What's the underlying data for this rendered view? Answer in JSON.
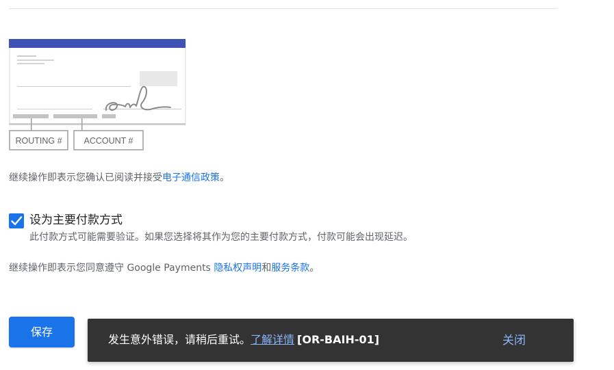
{
  "illustration": {
    "routing_label": "ROUTING #",
    "account_label": "ACCOUNT #",
    "accent_color": "#3f51b5"
  },
  "ecomm_terms": {
    "prefix": "继续操作即表示您确认已阅读并接受",
    "link": "电子通信政策",
    "suffix": "。"
  },
  "primary_payment": {
    "checked": true,
    "label": "设为主要付款方式",
    "note": "此付款方式可能需要验证。如果您选择将其作为您的主要付款方式，付款可能会出现延迟。"
  },
  "payments_terms": {
    "prefix": "继续操作即表示您同意遵守 Google Payments ",
    "privacy_link": "隐私权声明",
    "middle": "和",
    "tos_link": "服务条款",
    "suffix": "。"
  },
  "save_button": {
    "label": "保存",
    "color": "#1a73e8"
  },
  "snackbar": {
    "message": "发生意外错误，请稍后重试。",
    "link": "了解详情",
    "code": "[OR-BAIH-01]",
    "close_label": "关闭",
    "background": "#333333"
  }
}
